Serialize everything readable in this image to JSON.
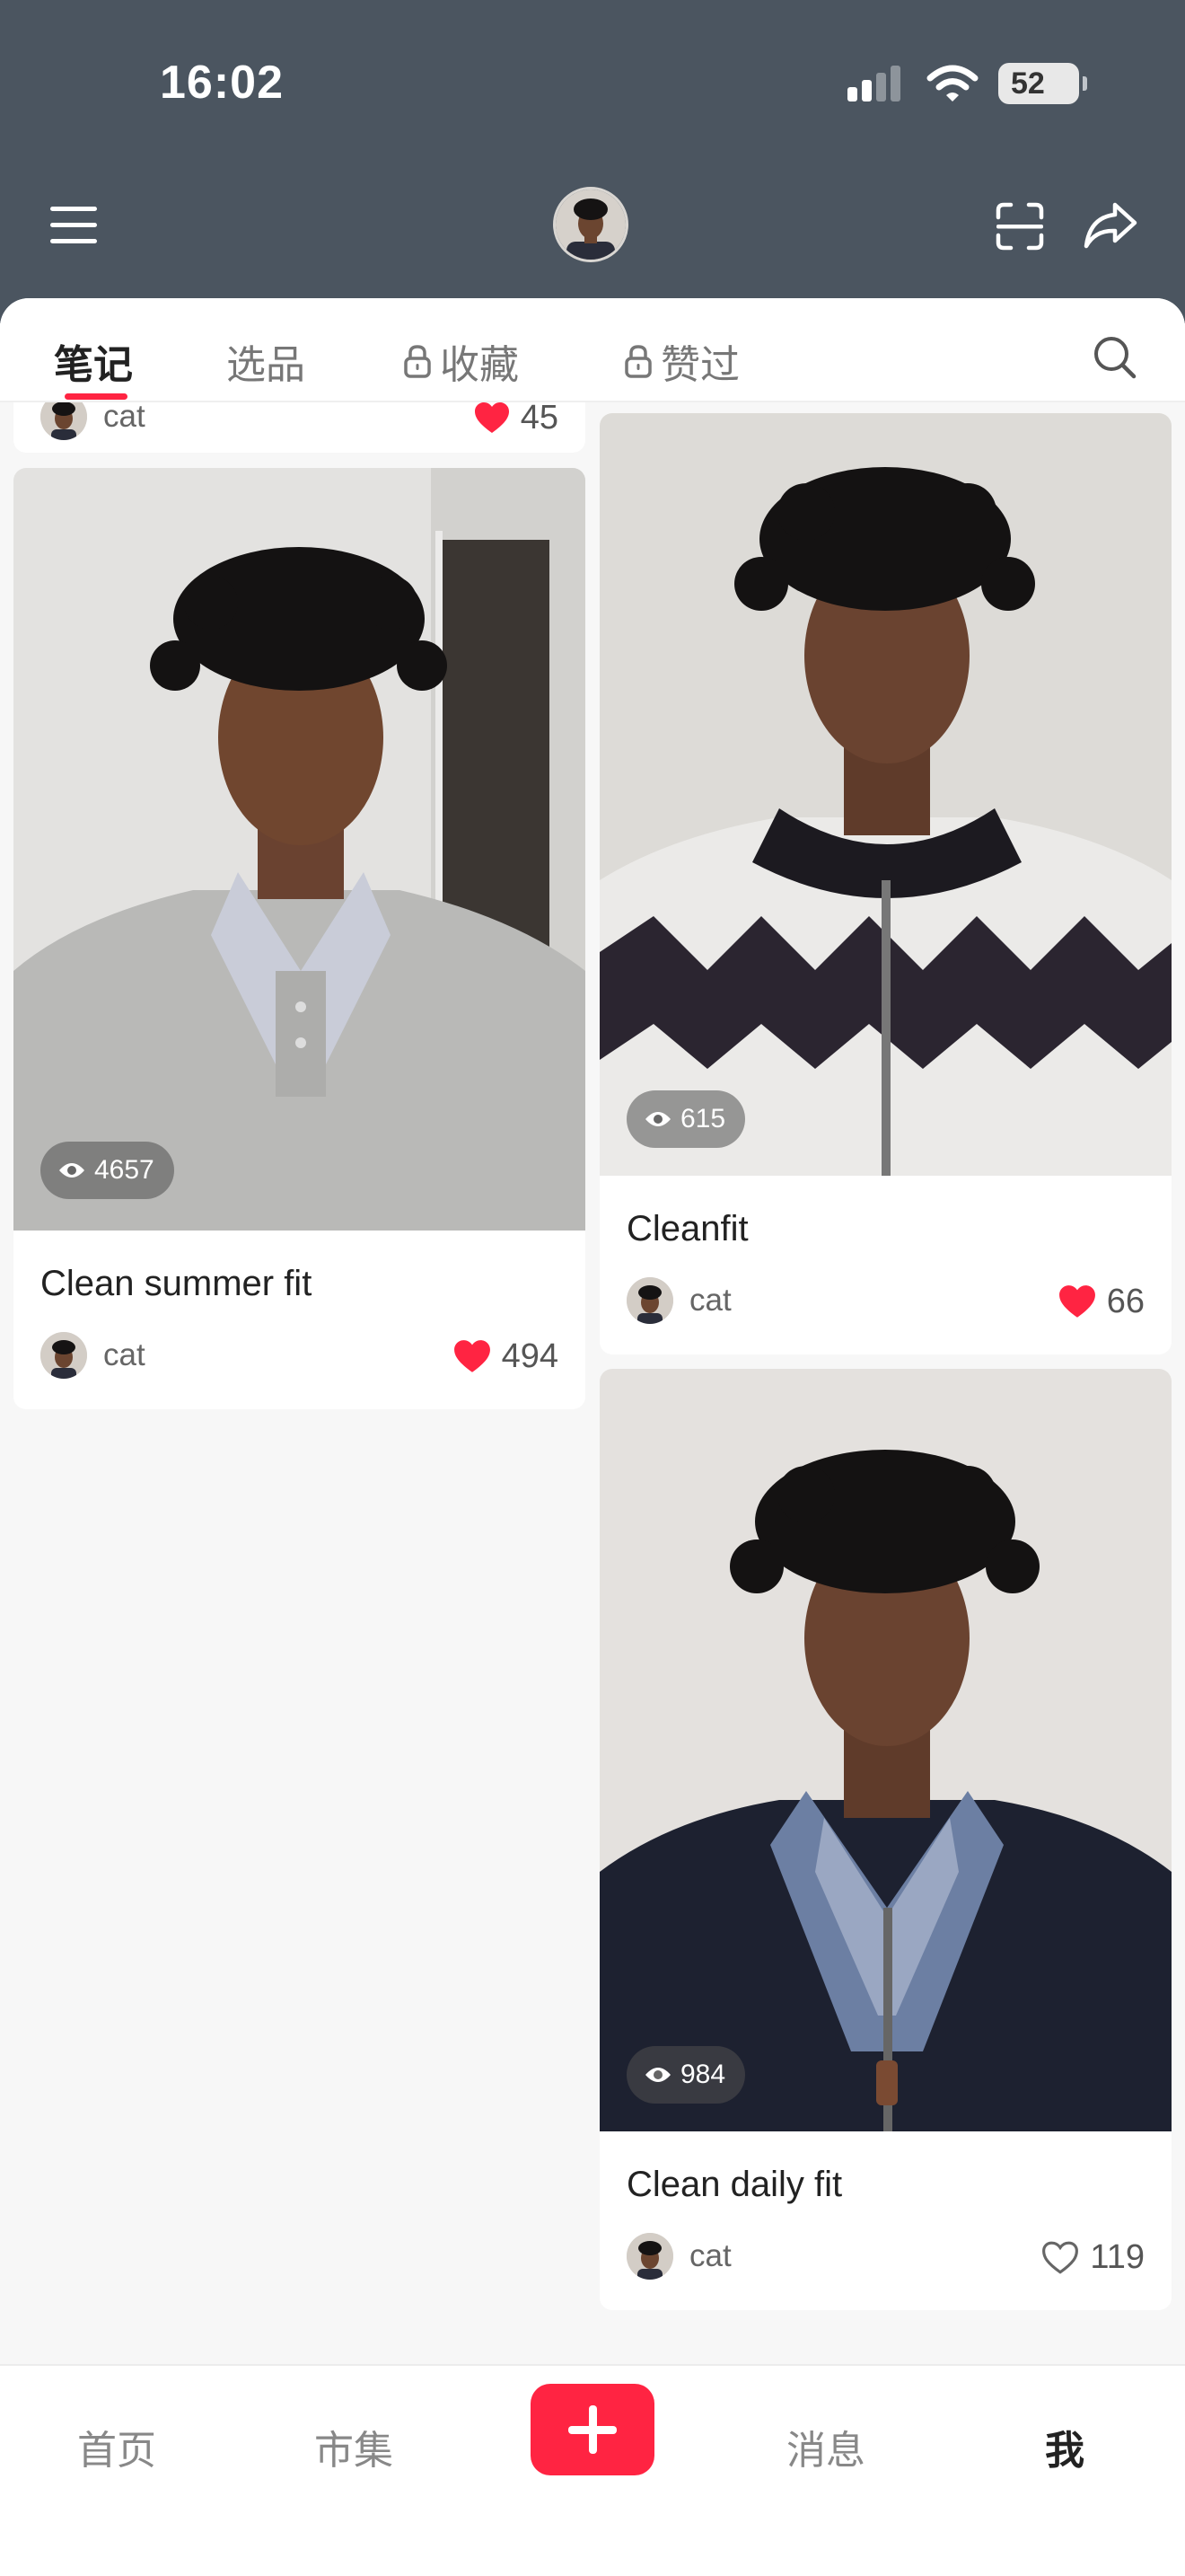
{
  "status_bar": {
    "time": "16:02",
    "battery": "52"
  },
  "tabs": [
    {
      "label": "笔记",
      "locked": false
    },
    {
      "label": "选品",
      "locked": false
    },
    {
      "label": "收藏",
      "locked": true
    },
    {
      "label": "赞过",
      "locked": true
    }
  ],
  "partial_card": {
    "author": "cat",
    "likes": "45"
  },
  "cards": [
    {
      "title": "Clean summer fit",
      "views": "4657",
      "author": "cat",
      "likes": "494",
      "liked": true,
      "sweater_color": "#b9b9b7"
    },
    {
      "title": "Cleanfit",
      "views": "615",
      "author": "cat",
      "likes": "66",
      "liked": true,
      "sweater_color": "#2b2530"
    },
    {
      "title": "Clean daily fit",
      "views": "984",
      "author": "cat",
      "likes": "119",
      "liked": false,
      "sweater_color": "#1d2130"
    }
  ],
  "bottom_nav": [
    {
      "label": "首页"
    },
    {
      "label": "市集"
    },
    {
      "label": "消息"
    },
    {
      "label": "我"
    }
  ],
  "colors": {
    "accent": "#ff2442",
    "header_bg": "#4b5560"
  }
}
